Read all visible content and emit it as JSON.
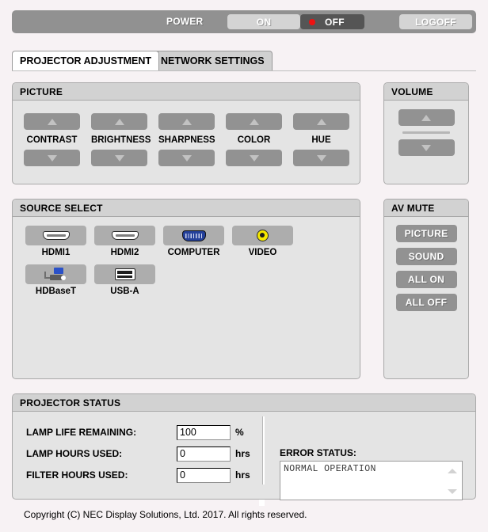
{
  "power_bar": {
    "label": "POWER",
    "on_label": "ON",
    "off_label": "OFF",
    "logoff_label": "LOGOFF",
    "active": "OFF",
    "led_color": "#ee1111"
  },
  "tabs": [
    {
      "label": "PROJECTOR ADJUSTMENT",
      "active": true
    },
    {
      "label": "NETWORK SETTINGS",
      "active": false
    }
  ],
  "picture": {
    "title": "PICTURE",
    "controls": [
      {
        "label": "CONTRAST",
        "up_icon": "triangle-up-icon",
        "down_icon": "triangle-down-icon"
      },
      {
        "label": "BRIGHTNESS",
        "up_icon": "triangle-up-icon",
        "down_icon": "triangle-down-icon"
      },
      {
        "label": "SHARPNESS",
        "up_icon": "triangle-up-icon",
        "down_icon": "triangle-down-icon"
      },
      {
        "label": "COLOR",
        "up_icon": "triangle-up-icon",
        "down_icon": "triangle-down-icon"
      },
      {
        "label": "HUE",
        "up_icon": "triangle-up-icon",
        "down_icon": "triangle-down-icon"
      }
    ]
  },
  "volume": {
    "title": "VOLUME",
    "up_icon": "triangle-up-icon",
    "down_icon": "triangle-down-icon"
  },
  "source_select": {
    "title": "SOURCE SELECT",
    "sources": [
      {
        "label": "HDMI1",
        "icon": "hdmi-connector-icon"
      },
      {
        "label": "HDMI2",
        "icon": "hdmi-connector-icon"
      },
      {
        "label": "COMPUTER",
        "icon": "vga-connector-icon"
      },
      {
        "label": "VIDEO",
        "icon": "rca-video-jack-icon"
      },
      {
        "label": "HDBaseT",
        "icon": "hdbaset-network-icon"
      },
      {
        "label": "USB-A",
        "icon": "usb-port-icon"
      }
    ]
  },
  "av_mute": {
    "title": "AV MUTE",
    "buttons": [
      {
        "label": "PICTURE"
      },
      {
        "label": "SOUND"
      },
      {
        "label": "ALL ON"
      },
      {
        "label": "ALL OFF"
      }
    ]
  },
  "projector_status": {
    "title": "PROJECTOR STATUS",
    "rows": [
      {
        "label": "LAMP LIFE REMAINING:",
        "value": "100",
        "unit": "%"
      },
      {
        "label": "LAMP HOURS USED:",
        "value": "0",
        "unit": "hrs"
      },
      {
        "label": "FILTER HOURS USED:",
        "value": "0",
        "unit": "hrs"
      }
    ],
    "error_status": {
      "label": "ERROR STATUS:",
      "text": "NORMAL OPERATION",
      "scroll_up_icon": "chevron-up-icon",
      "scroll_down_icon": "chevron-down-icon"
    }
  },
  "footer": {
    "copyright": "Copyright (C) NEC Display Solutions, Ltd. 2017. All rights reserved."
  }
}
